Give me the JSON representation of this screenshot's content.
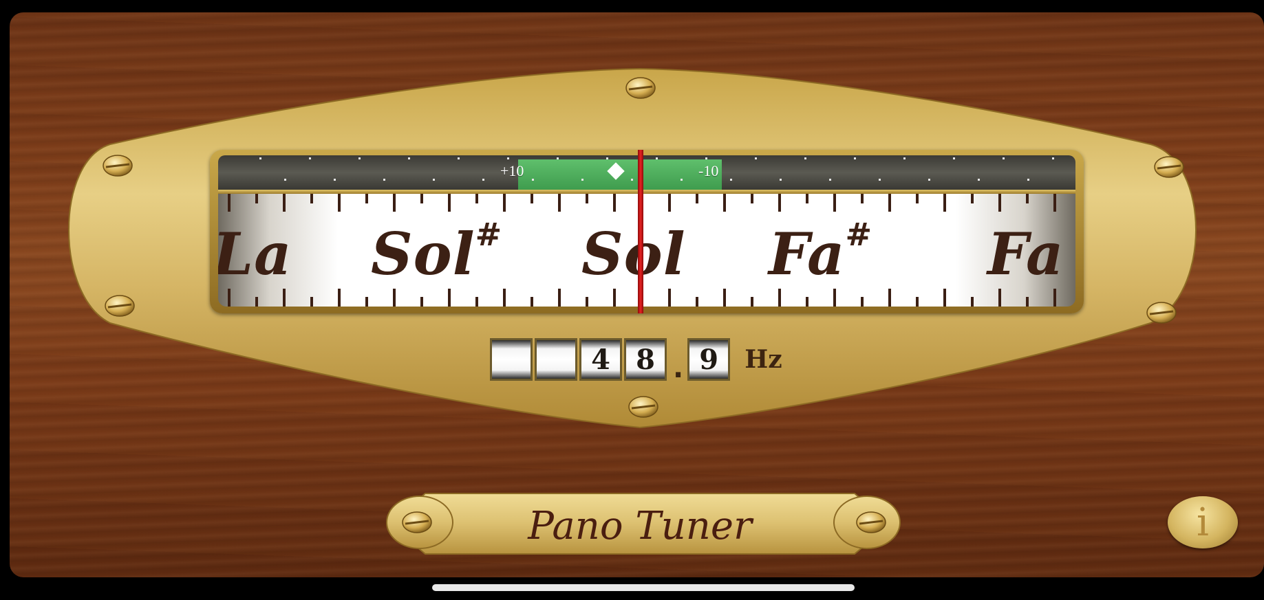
{
  "app": {
    "name": "Pano Tuner"
  },
  "cents_scale": {
    "left_label": "+10",
    "right_label": "-10",
    "deviation_cents": 0
  },
  "notes": [
    {
      "name": "La",
      "sharp": ""
    },
    {
      "name": "Sol",
      "sharp": "#"
    },
    {
      "name": "Sol",
      "sharp": ""
    },
    {
      "name": "Fa",
      "sharp": "#"
    },
    {
      "name": "Fa",
      "sharp": ""
    }
  ],
  "frequency": {
    "digits": [
      "",
      "",
      "4",
      "8"
    ],
    "decimal": "9",
    "unit": "Hz"
  },
  "info_button": {
    "label": "i"
  }
}
